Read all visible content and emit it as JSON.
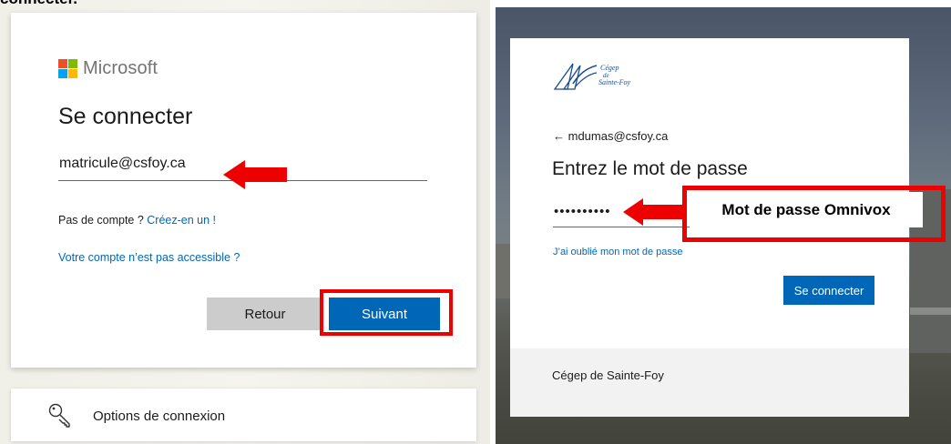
{
  "top_caption": "connecter.",
  "microsoft": {
    "brand": "Microsoft",
    "title": "Se connecter",
    "email_value": "matricule@csfoy.ca",
    "no_account_text": "Pas de compte ? ",
    "create_link": "Créez-en un !",
    "inaccessible_link": "Votre compte n’est pas accessible ?",
    "back_button": "Retour",
    "next_button": "Suivant",
    "options_label": "Options de connexion",
    "logo_colors": [
      "#f25022",
      "#7fba00",
      "#00a4ef",
      "#ffb900"
    ]
  },
  "cegep": {
    "logo_text": "Cégep de Sainte-Foy",
    "back_email": "← mdumas@csfoy.ca",
    "title": "Entrez le mot de passe",
    "password_value": "••••••••••",
    "forgot_link": "J’ai oublié mon mot de passe",
    "signin_button": "Se connecter",
    "footer": "Cégep de Sainte-Foy"
  },
  "annotations": {
    "password_hint": "Mot de passe Omnivox",
    "accent_color": "#ee0000"
  }
}
